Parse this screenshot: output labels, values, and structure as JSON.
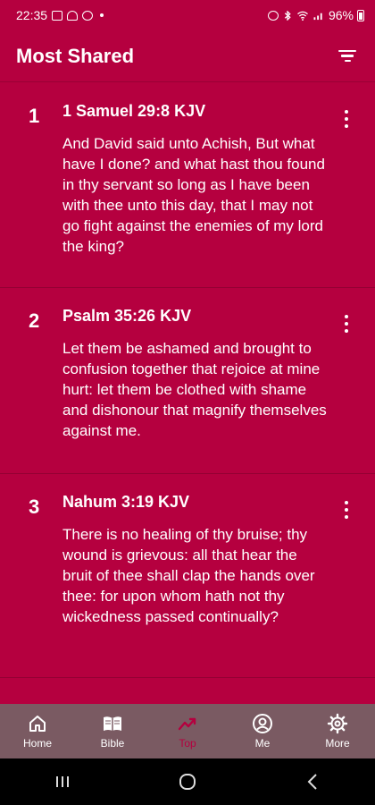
{
  "status": {
    "time": "22:35",
    "battery": "96%"
  },
  "header": {
    "title": "Most Shared"
  },
  "verses": [
    {
      "rank": "1",
      "ref": "1 Samuel 29:8 KJV",
      "text": "And David said unto Achish, But what have I done? and what hast thou found in thy servant so long as I have been with thee unto this day, that I may not go fight against the enemies of my lord the king?"
    },
    {
      "rank": "2",
      "ref": "Psalm 35:26 KJV",
      "text": "Let them be ashamed and brought to confusion together that rejoice at mine hurt: let them be clothed with shame and dishonour that magnify themselves against me."
    },
    {
      "rank": "3",
      "ref": "Nahum 3:19 KJV",
      "text": "There is no healing of thy bruise; thy wound is grievous: all that hear the bruit of thee shall clap the hands over thee: for upon whom hath not thy wickedness passed continually?"
    }
  ],
  "nav": {
    "items": [
      {
        "label": "Home",
        "icon": "home-icon"
      },
      {
        "label": "Bible",
        "icon": "book-icon"
      },
      {
        "label": "Top",
        "icon": "trending-icon",
        "active": true
      },
      {
        "label": "Me",
        "icon": "person-icon"
      },
      {
        "label": "More",
        "icon": "gear-icon"
      }
    ]
  },
  "colors": {
    "background": "#b5003f",
    "nav_background": "#7a5a62",
    "active": "#b5003f"
  }
}
